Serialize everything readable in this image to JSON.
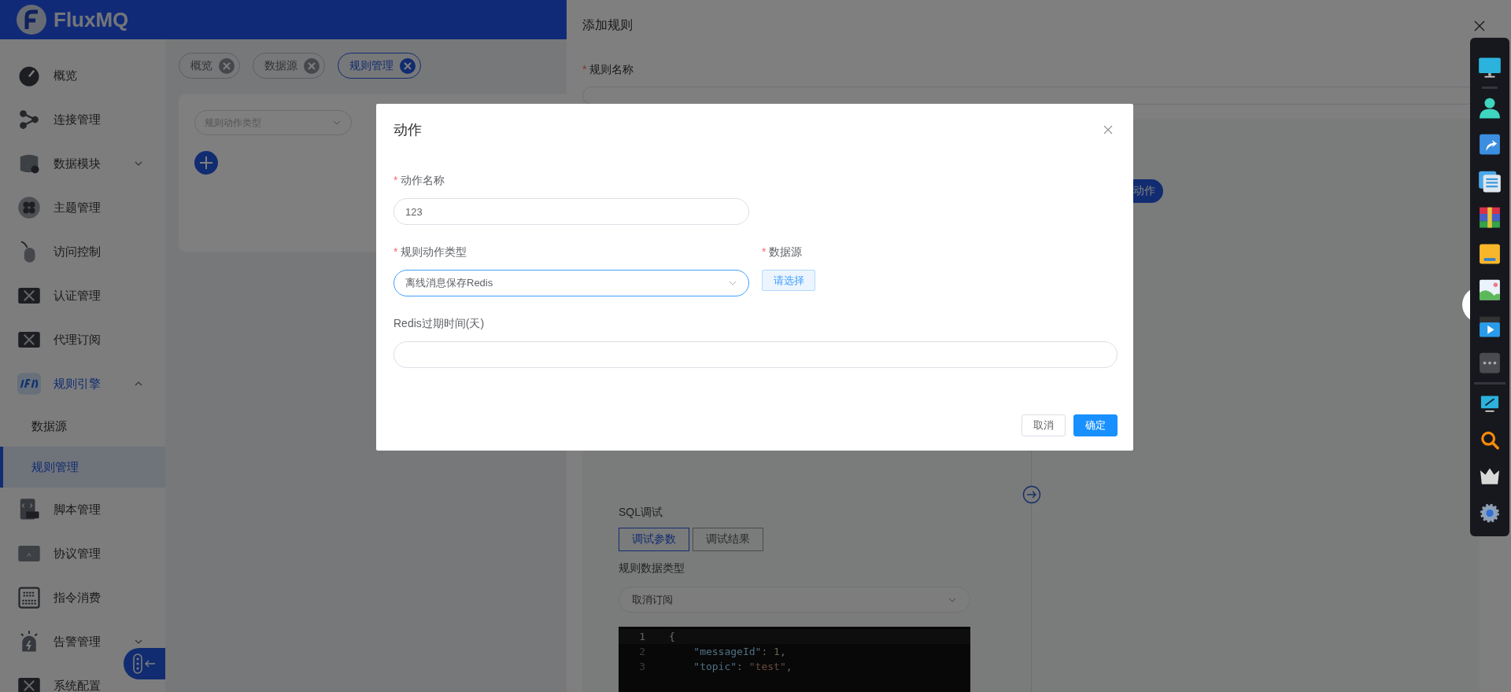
{
  "header": {
    "app_name": "FluxMQ"
  },
  "sidebar": {
    "items": [
      {
        "label": "概览",
        "kind": "link",
        "selected": false
      },
      {
        "label": "连接管理",
        "kind": "link",
        "selected": false
      },
      {
        "label": "数据模块",
        "kind": "group",
        "selected": false,
        "expanded": false
      },
      {
        "label": "主题管理",
        "kind": "link",
        "selected": false
      },
      {
        "label": "访问控制",
        "kind": "link",
        "selected": false
      },
      {
        "label": "认证管理",
        "kind": "link",
        "selected": false
      },
      {
        "label": "代理订阅",
        "kind": "link",
        "selected": false
      },
      {
        "label": "规则引擎",
        "kind": "group",
        "selected": true,
        "expanded": true,
        "children": [
          {
            "label": "数据源",
            "selected": false
          },
          {
            "label": "规则管理",
            "selected": true
          }
        ]
      },
      {
        "label": "脚本管理",
        "kind": "link",
        "selected": false
      },
      {
        "label": "协议管理",
        "kind": "link",
        "selected": false
      },
      {
        "label": "指令消费",
        "kind": "link",
        "selected": false
      },
      {
        "label": "告警管理",
        "kind": "group",
        "selected": false,
        "expanded": false
      },
      {
        "label": "系统配置",
        "kind": "link",
        "selected": false
      }
    ]
  },
  "tabs": [
    {
      "label": "概览",
      "selected": false
    },
    {
      "label": "数据源",
      "selected": false
    },
    {
      "label": "规则管理",
      "selected": true
    }
  ],
  "main_card": {
    "filter_select": {
      "placeholder": "规则动作类型"
    }
  },
  "drawer": {
    "title": "添加规则",
    "name_field": {
      "required_mark": "*",
      "label": "规则名称"
    },
    "add_action_button": "动作",
    "sql_debug": {
      "title": "SQL调试",
      "tabs": [
        {
          "label": "调试参数",
          "selected": true
        },
        {
          "label": "调试结果",
          "selected": false
        }
      ],
      "data_type": {
        "label": "规则数据类型",
        "value": "取消订阅"
      },
      "code_lines": [
        {
          "number": "1",
          "current": true,
          "tokens": [
            {
              "kind": "punct",
              "text": "{"
            }
          ]
        },
        {
          "number": "2",
          "current": false,
          "tokens": [
            {
              "kind": "key",
              "text": "    \"messageId\""
            },
            {
              "kind": "punct",
              "text": ": "
            },
            {
              "kind": "number",
              "text": "1"
            },
            {
              "kind": "punct",
              "text": ","
            }
          ]
        },
        {
          "number": "3",
          "current": false,
          "tokens": [
            {
              "kind": "key",
              "text": "    \"topic\""
            },
            {
              "kind": "punct",
              "text": ": "
            },
            {
              "kind": "string",
              "text": "\"test\""
            },
            {
              "kind": "punct",
              "text": ","
            }
          ]
        }
      ]
    }
  },
  "modal": {
    "title": "动作",
    "name_field": {
      "required_mark": "*",
      "label": "动作名称",
      "value": "123"
    },
    "type_field": {
      "required_mark": "*",
      "label": "规则动作类型",
      "value": "离线消息保存Redis",
      "focused": true
    },
    "datasource_field": {
      "required_mark": "*",
      "label": "数据源",
      "button": "请选择"
    },
    "expire_field": {
      "label": "Redis过期时间(天)"
    },
    "buttons": [
      {
        "label": "取消",
        "kind": "default"
      },
      {
        "label": "确定",
        "kind": "primary"
      }
    ]
  }
}
